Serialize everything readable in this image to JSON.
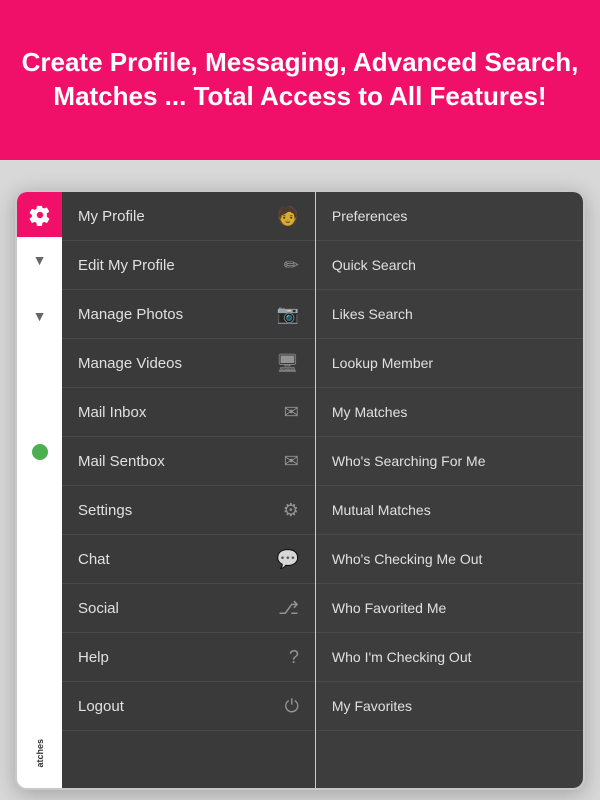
{
  "banner": {
    "text": "Create Profile, Messaging, Advanced Search, Matches ... Total Access to All Features!",
    "background": "#f0106a"
  },
  "sidebar": {
    "items": [
      {
        "id": "my-profile",
        "label": "My Profile",
        "icon": "person"
      },
      {
        "id": "edit-my-profile",
        "label": "Edit My Profile",
        "icon": "edit"
      },
      {
        "id": "manage-photos",
        "label": "Manage Photos",
        "icon": "camera"
      },
      {
        "id": "manage-videos",
        "label": "Manage Videos",
        "icon": "video"
      },
      {
        "id": "mail-inbox",
        "label": "Mail Inbox",
        "icon": "mail"
      },
      {
        "id": "mail-sentbox",
        "label": "Mail Sentbox",
        "icon": "mailsent"
      },
      {
        "id": "settings",
        "label": "Settings",
        "icon": "gear"
      },
      {
        "id": "chat",
        "label": "Chat",
        "icon": "chat"
      },
      {
        "id": "social",
        "label": "Social",
        "icon": "share"
      },
      {
        "id": "help",
        "label": "Help",
        "icon": "help"
      },
      {
        "id": "logout",
        "label": "Logout",
        "icon": "power"
      }
    ]
  },
  "right_menu": {
    "items": [
      {
        "id": "preferences",
        "label": "Preferences"
      },
      {
        "id": "quick-search",
        "label": "Quick Search"
      },
      {
        "id": "likes-search",
        "label": "Likes Search"
      },
      {
        "id": "lookup-member",
        "label": "Lookup Member"
      },
      {
        "id": "my-matches",
        "label": "My Matches"
      },
      {
        "id": "whos-searching-for-me",
        "label": "Who's Searching For Me"
      },
      {
        "id": "mutual-matches",
        "label": "Mutual Matches"
      },
      {
        "id": "whos-checking-me-out",
        "label": "Who's Checking Me Out"
      },
      {
        "id": "who-favorited-me",
        "label": "Who Favorited Me"
      },
      {
        "id": "who-im-checking-out",
        "label": "Who I'm Checking Out"
      },
      {
        "id": "my-favorites",
        "label": "My Favorites"
      }
    ]
  },
  "left_edge": {
    "bottom_label": "atches"
  }
}
